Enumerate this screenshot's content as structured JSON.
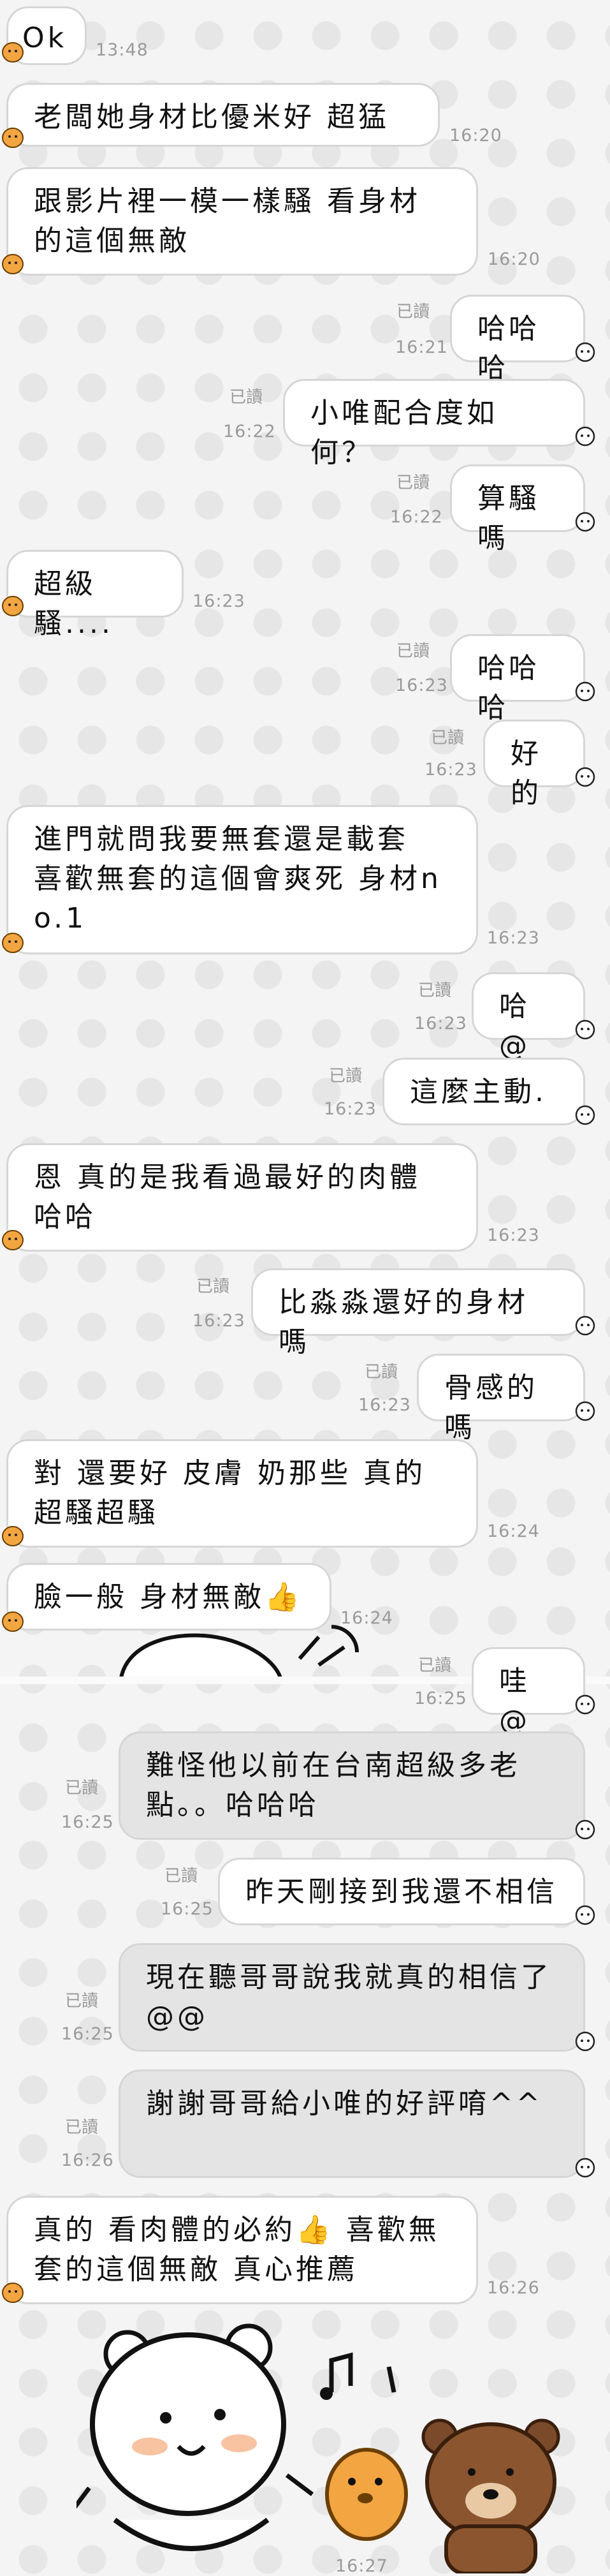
{
  "messages": [
    {
      "side": "in",
      "text": "Ok",
      "time": "13:48"
    },
    {
      "side": "in",
      "text": "老闆她身材比優米好 超猛",
      "time": "16:20"
    },
    {
      "side": "in",
      "text": "跟影片裡一模一樣騷 看身材的這個無敵",
      "time": "16:20"
    },
    {
      "side": "out",
      "text": "哈哈哈",
      "time": "16:21",
      "read": "已讀"
    },
    {
      "side": "out",
      "text": "小唯配合度如何？",
      "time": "16:22",
      "read": "已讀"
    },
    {
      "side": "out",
      "text": "算騷嗎",
      "time": "16:22",
      "read": "已讀"
    },
    {
      "side": "in",
      "text": "超級騷....",
      "time": "16:23"
    },
    {
      "side": "out",
      "text": "哈哈哈",
      "time": "16:23",
      "read": "已讀"
    },
    {
      "side": "out",
      "text": "好的",
      "time": "16:23",
      "read": "已讀"
    },
    {
      "side": "in",
      "text": "進門就問我要無套還是載套\n喜歡無套的這個會爽死 身材no.1",
      "time": "16:23"
    },
    {
      "side": "out",
      "text": "哈@@",
      "time": "16:23",
      "read": "已讀"
    },
    {
      "side": "out",
      "text": "這麼主動.",
      "time": "16:23",
      "read": "已讀"
    },
    {
      "side": "in",
      "text": "恩 真的是我看過最好的肉體\n哈哈",
      "time": "16:23"
    },
    {
      "side": "out",
      "text": "比淼淼還好的身材嗎",
      "time": "16:23",
      "read": "已讀"
    },
    {
      "side": "out",
      "text": "骨感的嗎",
      "time": "16:23",
      "read": "已讀"
    },
    {
      "side": "in",
      "text": "對 還要好 皮膚 奶那些 真的超騷超騷",
      "time": "16:24"
    },
    {
      "side": "in",
      "text": "臉一般 身材無敵👍",
      "time": "16:24"
    },
    {
      "side": "out",
      "text": "哇@@",
      "time": "16:25",
      "read": "已讀"
    },
    {
      "side": "out",
      "text": "難怪他以前在台南超級多老點。。哈哈哈",
      "time": "16:25",
      "read": "已讀"
    },
    {
      "side": "out",
      "text": "昨天剛接到我還不相信",
      "time": "16:25",
      "read": "已讀"
    },
    {
      "side": "out",
      "text": "現在聽哥哥說我就真的相信了@@",
      "time": "16:25",
      "read": "已讀"
    },
    {
      "side": "out",
      "text": "謝謝哥哥給小唯的好評唷^^",
      "time": "16:26",
      "read": "已讀"
    },
    {
      "side": "in",
      "text": "真的 看肉體的必約👍 喜歡無套的這個無敵 真心推薦",
      "time": "16:26"
    }
  ],
  "sticker": {
    "name": "bear-chick-music-sticker",
    "time": "16:27"
  },
  "colors": {
    "bubble_border": "#d6d6d6",
    "bubble_fill": "#ffffff",
    "bubble_fill_alt": "#e4e4e4",
    "chick": "#f2a541",
    "text": "#111111",
    "meta": "#9a9a9a"
  },
  "icons": {
    "incoming_avatar": "chick-avatar-icon",
    "outgoing_avatar": "ghost-avatar-icon"
  }
}
